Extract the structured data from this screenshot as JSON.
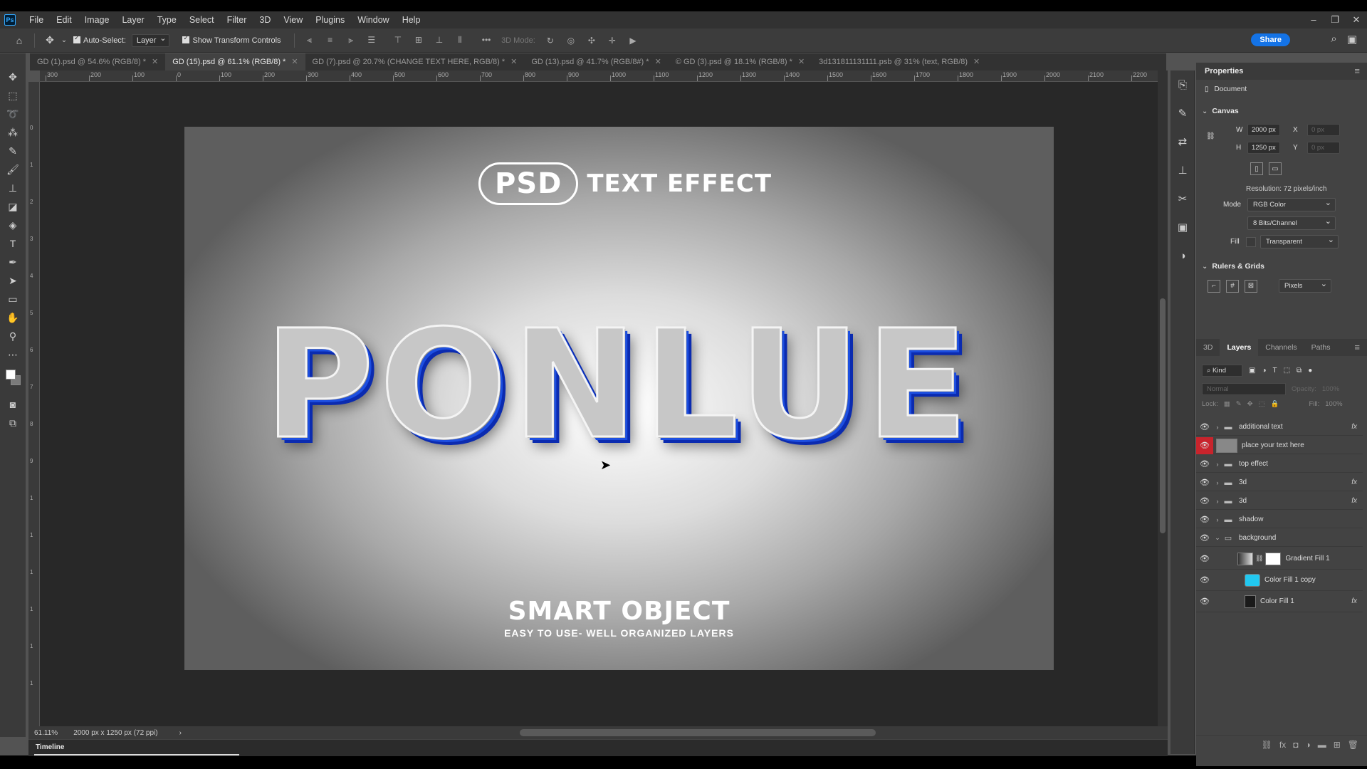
{
  "menu": {
    "logo": "Ps",
    "items": [
      "File",
      "Edit",
      "Image",
      "Layer",
      "Type",
      "Select",
      "Filter",
      "3D",
      "View",
      "Plugins",
      "Window",
      "Help"
    ]
  },
  "options": {
    "auto_select_label": "Auto-Select:",
    "auto_select_value": "Layer",
    "show_transform_label": "Show Transform Controls",
    "mode_3d_label": "3D Mode:",
    "share_label": "Share"
  },
  "tabs": [
    {
      "label": "GD (1).psd @ 54.6% (RGB/8) *",
      "active": false
    },
    {
      "label": "GD (15).psd @ 61.1% (RGB/8) *",
      "active": true
    },
    {
      "label": "GD (7).psd @ 20.7% (CHANGE TEXT HERE, RGB/8) *",
      "active": false
    },
    {
      "label": "GD (13).psd @ 41.7% (RGB/8#) *",
      "active": false
    },
    {
      "label": "© GD (3).psd @ 18.1% (RGB/8) *",
      "active": false
    },
    {
      "label": "3d131811131111.psb @ 31% (text, RGB/8)",
      "active": false
    }
  ],
  "ruler_h_labels": [
    "300",
    "200",
    "100",
    "0",
    "100",
    "200",
    "300",
    "400",
    "500",
    "600",
    "700",
    "800",
    "900",
    "1000",
    "1100",
    "1200",
    "1300",
    "1400",
    "1500",
    "1600",
    "1700",
    "1800",
    "1900",
    "2000",
    "2100",
    "2200"
  ],
  "ruler_v_labels": [
    "0",
    "1",
    "2",
    "3",
    "4",
    "5",
    "6",
    "7",
    "8",
    "9",
    "1",
    "1",
    "1",
    "1",
    "1",
    "1"
  ],
  "canvas": {
    "psd_pill": "PSD",
    "psd_title": "TEXT EFFECT",
    "main_text": "PONLUE",
    "smart_title": "SMART OBJECT",
    "smart_sub": "EASY TO USE- WELL ORGANIZED LAYERS"
  },
  "status": {
    "zoom": "61.11%",
    "doc_size": "2000 px x 1250 px (72 ppi)"
  },
  "timeline": {
    "label": "Timeline"
  },
  "properties": {
    "title": "Properties",
    "document_label": "Document",
    "canvas_section": "Canvas",
    "w_label": "W",
    "w_value": "2000 px",
    "h_label": "H",
    "h_value": "1250 px",
    "x_label": "X",
    "x_value": "0 px",
    "y_label": "Y",
    "y_value": "0 px",
    "resolution": "Resolution: 72 pixels/inch",
    "mode_label": "Mode",
    "mode_value": "RGB Color",
    "depth_value": "8 Bits/Channel",
    "fill_label": "Fill",
    "fill_value": "Transparent",
    "rulers_section": "Rulers & Grids",
    "units_value": "Pixels"
  },
  "layers_panel": {
    "tabs": [
      "3D",
      "Layers",
      "Channels",
      "Paths"
    ],
    "kind_label": "Kind",
    "blend_mode": "Normal",
    "opacity_label": "Opacity:",
    "opacity_value": "100%",
    "lock_label": "Lock:",
    "fill_label": "Fill:",
    "fill_value": "100%",
    "layers": [
      {
        "name": "additional text",
        "type": "folder",
        "fx": true,
        "selected_eye": false
      },
      {
        "name": "place your text here",
        "type": "smart",
        "fx": false,
        "selected_eye": true
      },
      {
        "name": "top effect",
        "type": "folder",
        "fx": false,
        "selected_eye": false
      },
      {
        "name": "3d",
        "type": "folder",
        "fx": true,
        "selected_eye": false
      },
      {
        "name": "3d",
        "type": "folder",
        "fx": true,
        "selected_eye": false
      },
      {
        "name": "shadow",
        "type": "folder",
        "fx": false,
        "selected_eye": false
      },
      {
        "name": "background",
        "type": "folder-open",
        "fx": false,
        "selected_eye": false
      },
      {
        "name": "Gradient Fill 1",
        "type": "gradient",
        "fx": false,
        "selected_eye": false
      },
      {
        "name": "Color Fill 1 copy",
        "type": "color-cyan",
        "fx": false,
        "selected_eye": false
      },
      {
        "name": "Color Fill 1",
        "type": "color-dark",
        "fx": true,
        "selected_eye": false
      }
    ]
  },
  "colors": {
    "accent": "#1473e6",
    "selected_eye": "#c8242c",
    "text_blue": "#1d4fe0"
  }
}
